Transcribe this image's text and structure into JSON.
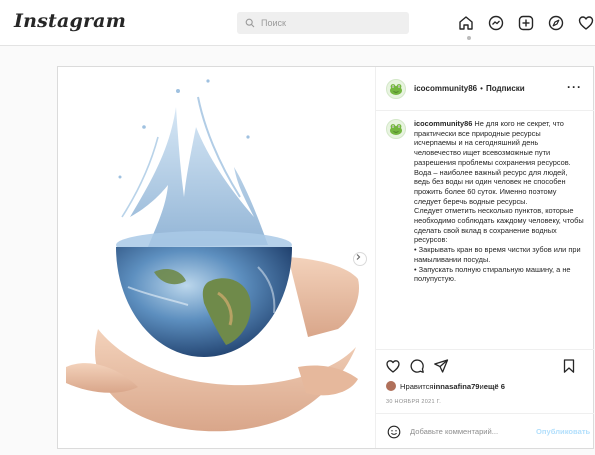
{
  "header": {
    "logo_text": "Instagram",
    "search_placeholder": "Поиск",
    "nav_icons": [
      "home-icon",
      "messenger-icon",
      "new-post-icon",
      "explore-icon",
      "activity-heart-icon"
    ]
  },
  "post": {
    "username": "icocommunity86",
    "separator": "•",
    "follow_label": "Подписки",
    "more_label": "···",
    "caption_user": "icocommunity86",
    "caption_lines": [
      "Не для кого не секрет, что практически все природные ресурсы исчерпаемы и на сегодняшний день человечество ищет всевозможные пути разрешения проблемы сохранения ресурсов. Вода – наиболее важный ресурс для людей, ведь без воды ни один человек не способен прожить более 60 суток. Именно поэтому следует беречь водные ресурсы.",
      "Следует отметить несколько пунктов, которые необходимо соблюдать каждому человеку, чтобы сделать свой вклад в сохранение водных ресурсов:",
      "• Закрывать кран во время чистки зубов или при намыливании посуды.",
      "• Запускать полную стиральную машину, а не полупустую."
    ],
    "likes_prefix": "Нравится ",
    "likes_user": "innasafina79",
    "likes_mid": " и ",
    "likes_more": "ещё 6",
    "date": "30 ноября 2021 г.",
    "comment_placeholder": "Добавьте комментарий...",
    "publish_label": "Опубликовать"
  },
  "colors": {
    "text": "#262626",
    "muted": "#8e8e8e",
    "publish_disabled": "#b2dffc",
    "border": "#dbdbdb"
  },
  "icons": [
    "search-icon",
    "next-arrow-icon",
    "heart-icon",
    "comment-icon",
    "share-icon",
    "bookmark-icon",
    "emoji-icon",
    "frog-avatar-icon"
  ]
}
